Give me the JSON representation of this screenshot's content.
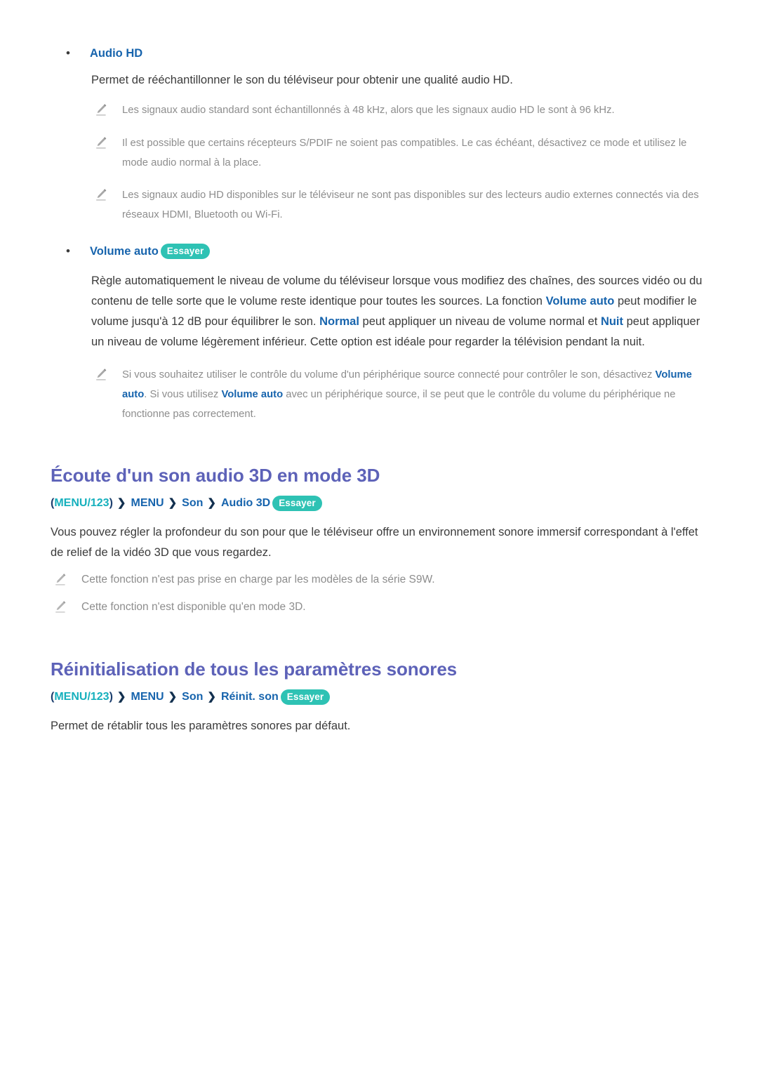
{
  "badges": {
    "essayer": "Essayer"
  },
  "colors": {
    "heading": "#5d62b8",
    "term_blue": "#1764ad",
    "menu_key_teal": "#16b0bd",
    "badge_teal": "#2ec2b4",
    "note_gray": "#8d8d8d",
    "body_gray": "#3b3b3b"
  },
  "audio_hd": {
    "bullet_label": "Audio HD",
    "description": "Permet de rééchantillonner le son du téléviseur pour obtenir une qualité audio HD.",
    "notes": [
      "Les signaux audio standard sont échantillonnés à 48 kHz, alors que les signaux audio HD le sont à 96 kHz.",
      "Il est possible que certains récepteurs S/PDIF ne soient pas compatibles. Le cas échéant, désactivez ce mode et utilisez le mode audio normal à la place.",
      "Les signaux audio HD disponibles sur le téléviseur ne sont pas disponibles sur des lecteurs audio externes connectés via des réseaux HDMI, Bluetooth ou Wi-Fi."
    ]
  },
  "volume_auto": {
    "bullet_label": "Volume auto",
    "paragraph": {
      "part1": "Règle automatiquement le niveau de volume du téléviseur lorsque vous modifiez des chaînes, des sources vidéo ou du contenu de telle sorte que le volume reste identique pour toutes les sources. La fonction ",
      "term1": "Volume auto",
      "part2": " peut modifier le volume jusqu'à 12 dB pour équilibrer le son. ",
      "term2": "Normal",
      "part3": " peut appliquer un niveau de volume normal et ",
      "term3": "Nuit",
      "part4": " peut appliquer un niveau de volume légèrement inférieur. Cette option est idéale pour regarder la télévision pendant la nuit."
    },
    "note": {
      "part1": "Si vous souhaitez utiliser le contrôle du volume d'un périphérique source connecté pour contrôler le son, désactivez ",
      "term1": "Volume auto",
      "part2": ". Si vous utilisez ",
      "term2": "Volume auto",
      "part3": " avec un périphérique source, il se peut que le contrôle du volume du périphérique ne fonctionne pas correctement."
    }
  },
  "section_3d": {
    "heading": "Écoute d'un son audio 3D en mode 3D",
    "menu_path": {
      "open_paren": "(",
      "key": "MENU/123",
      "close_paren": ")",
      "arrow": "❯",
      "items": [
        "MENU",
        "Son",
        "Audio 3D"
      ]
    },
    "paragraph": "Vous pouvez régler la profondeur du son pour que le téléviseur offre un environnement sonore immersif correspondant à l'effet de relief de la vidéo 3D que vous regardez.",
    "notes": [
      "Cette fonction n'est pas prise en charge par les modèles de la série S9W.",
      "Cette fonction n'est disponible qu'en mode 3D."
    ]
  },
  "section_reset": {
    "heading": "Réinitialisation de tous les paramètres sonores",
    "menu_path": {
      "open_paren": "(",
      "key": "MENU/123",
      "close_paren": ")",
      "arrow": "❯",
      "items": [
        "MENU",
        "Son",
        "Réinit. son"
      ]
    },
    "paragraph": "Permet de rétablir tous les paramètres sonores par défaut."
  },
  "icons": {
    "note": "pencil-note-icon",
    "bullet": "bullet-dot-icon",
    "arrow": "chevron-right-icon"
  }
}
